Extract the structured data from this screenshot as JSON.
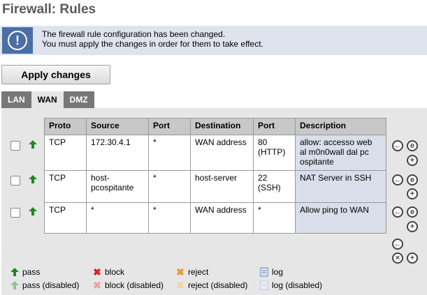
{
  "page": {
    "title": "Firewall: Rules"
  },
  "notice": {
    "line1": "The firewall rule configuration has been changed.",
    "line2": "You must apply the changes in order for them to take effect."
  },
  "apply_label": "Apply changes",
  "tabs": [
    {
      "label": "LAN"
    },
    {
      "label": "WAN"
    },
    {
      "label": "DMZ"
    }
  ],
  "table": {
    "headers": [
      "Proto",
      "Source",
      "Port",
      "Destination",
      "Port",
      "Description"
    ],
    "rows": [
      {
        "proto": "TCP",
        "source": "172.30.4.1",
        "sport": "*",
        "dest": "WAN address",
        "dport_1": "80",
        "dport_2": "(HTTP)",
        "desc_1": "allow: accesso web",
        "desc_2": "al m0n0wall dal pc",
        "desc_3": "ospitante"
      },
      {
        "proto": "TCP",
        "source_1": "host-",
        "source_2": "pcospitante",
        "sport": "*",
        "dest": "host-server",
        "dport_1": "22",
        "dport_2": "(SSH)",
        "desc_1": "NAT Server in SSH"
      },
      {
        "proto": "TCP",
        "source": "*",
        "sport": "*",
        "dest": "WAN address",
        "dport_1": "*",
        "desc_1": "Allow ping to WAN"
      }
    ]
  },
  "legend": {
    "pass": "pass",
    "pass_disabled": "pass (disabled)",
    "block": "block",
    "block_disabled": "block (disabled)",
    "reject": "reject",
    "reject_disabled": "reject (disabled)",
    "log": "log",
    "log_disabled": "log (disabled)"
  }
}
